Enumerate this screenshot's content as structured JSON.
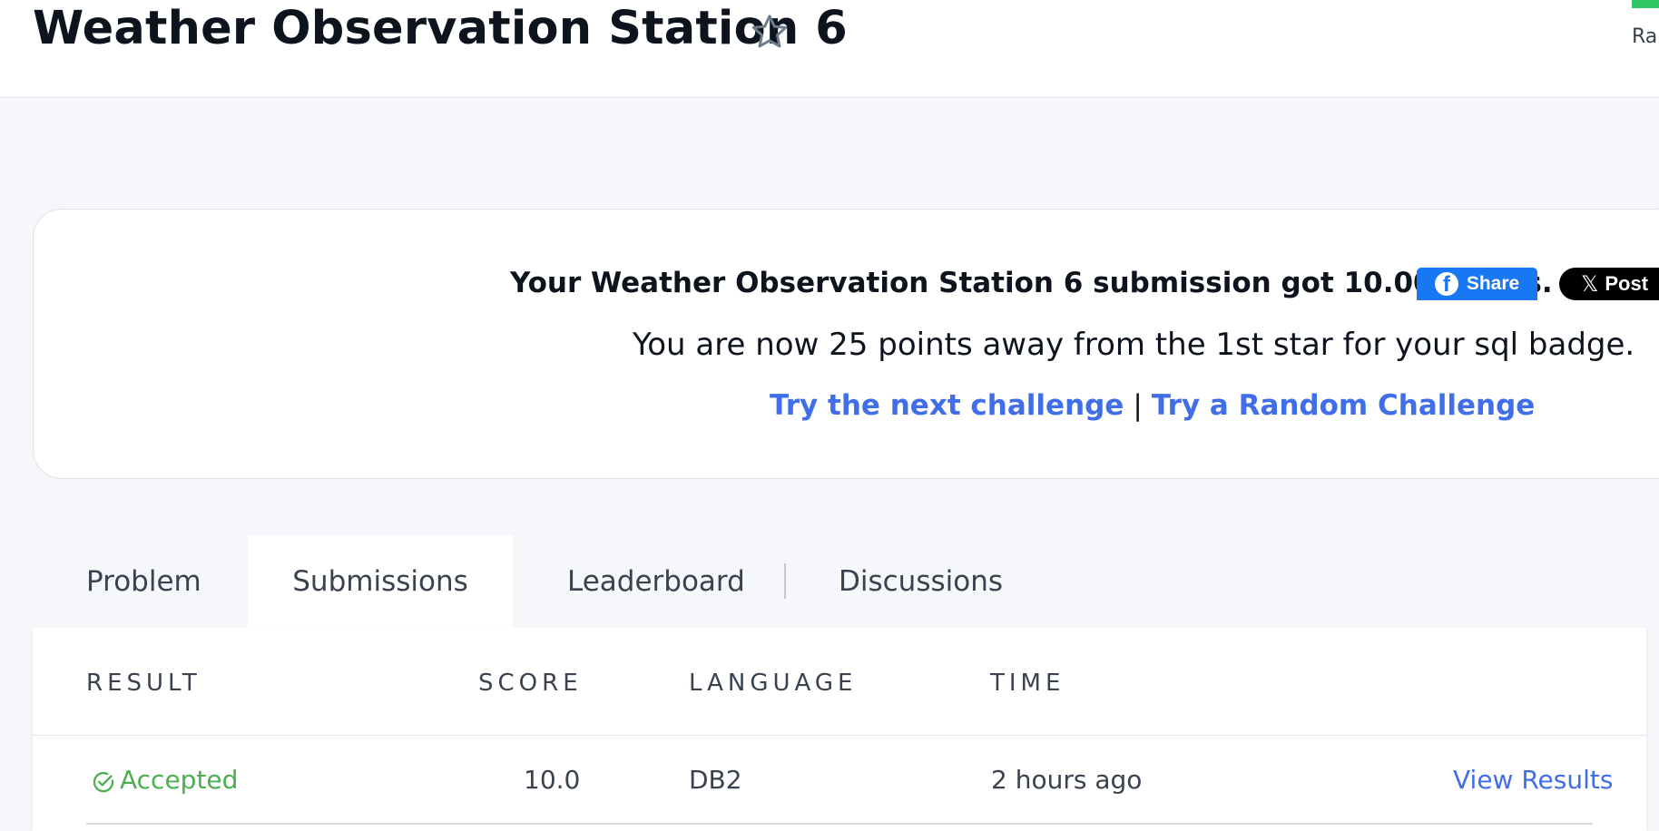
{
  "header": {
    "title": "Weather Observation Station 6",
    "star_icon": "star-outline-icon",
    "rank_label": "Ran"
  },
  "congrats": {
    "message": "Your Weather Observation Station 6 submission got 10.00 points.",
    "share_label": "Share",
    "share_icon": "facebook-icon",
    "post_label": "Post",
    "post_icon": "x-logo-icon",
    "progress_message": "You are now 25 points away from the 1st star for your sql badge.",
    "next_challenge_label": "Try the next challenge",
    "separator": "|",
    "random_challenge_label": "Try a Random Challenge"
  },
  "tabs": [
    {
      "label": "Problem",
      "active": false
    },
    {
      "label": "Submissions",
      "active": true
    },
    {
      "label": "Leaderboard",
      "active": false
    },
    {
      "label": "Discussions",
      "active": false
    }
  ],
  "submissions": {
    "columns": [
      "RESULT",
      "SCORE",
      "LANGUAGE",
      "TIME"
    ],
    "rows": [
      {
        "result": "Accepted",
        "result_icon": "check-circle-icon",
        "score": "10.0",
        "language": "DB2",
        "time": "2 hours ago",
        "action": "View Results"
      }
    ]
  },
  "colors": {
    "accent_link": "#3f6ee8",
    "accepted_green": "#4caf50",
    "facebook_blue": "#1877f2",
    "rank_green": "#2ec866"
  }
}
